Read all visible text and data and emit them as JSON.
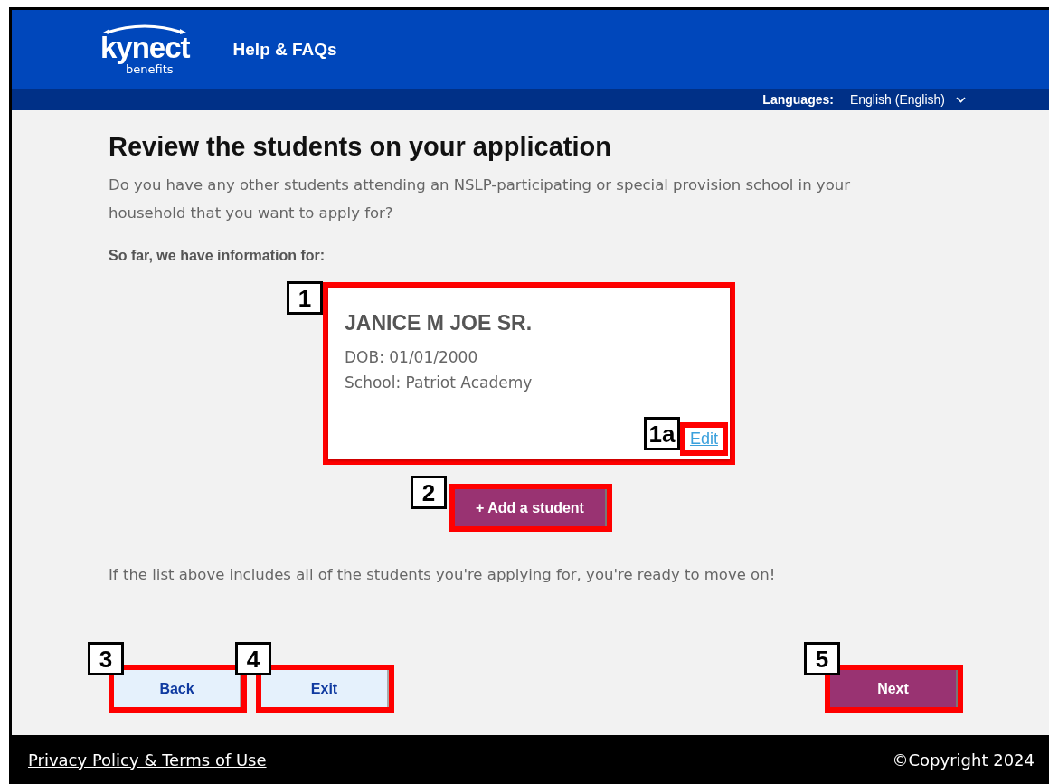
{
  "header": {
    "logo_word": "kynect",
    "logo_sub": "benefits",
    "help_link": "Help & FAQs"
  },
  "language_bar": {
    "label": "Languages:",
    "value": "English (English)"
  },
  "page": {
    "title": "Review the students on your application",
    "question": "Do you have any other students attending an NSLP-participating or special provision school in your household that you want to apply for?",
    "summary_label": "So far, we have information for:",
    "students": [
      {
        "name": "JANICE M JOE SR.",
        "dob": "DOB: 01/01/2000",
        "school": "School: Patriot Academy",
        "edit": "Edit",
        "callout": "1",
        "edit_callout": "1a"
      }
    ],
    "add_button": {
      "label": "+ Add a student",
      "callout": "2"
    },
    "note": "If the list above includes all of the students you're applying for, you're ready to move on!",
    "actions": [
      {
        "kind": "secondary",
        "label": "Back",
        "callout": "3"
      },
      {
        "kind": "secondary",
        "label": "Exit",
        "callout": "4"
      },
      {
        "kind": "primary",
        "label": "Next",
        "callout": "5"
      }
    ]
  },
  "footer": {
    "link": "Privacy Policy & Terms of Use",
    "copyright": "©Copyright 2024"
  }
}
